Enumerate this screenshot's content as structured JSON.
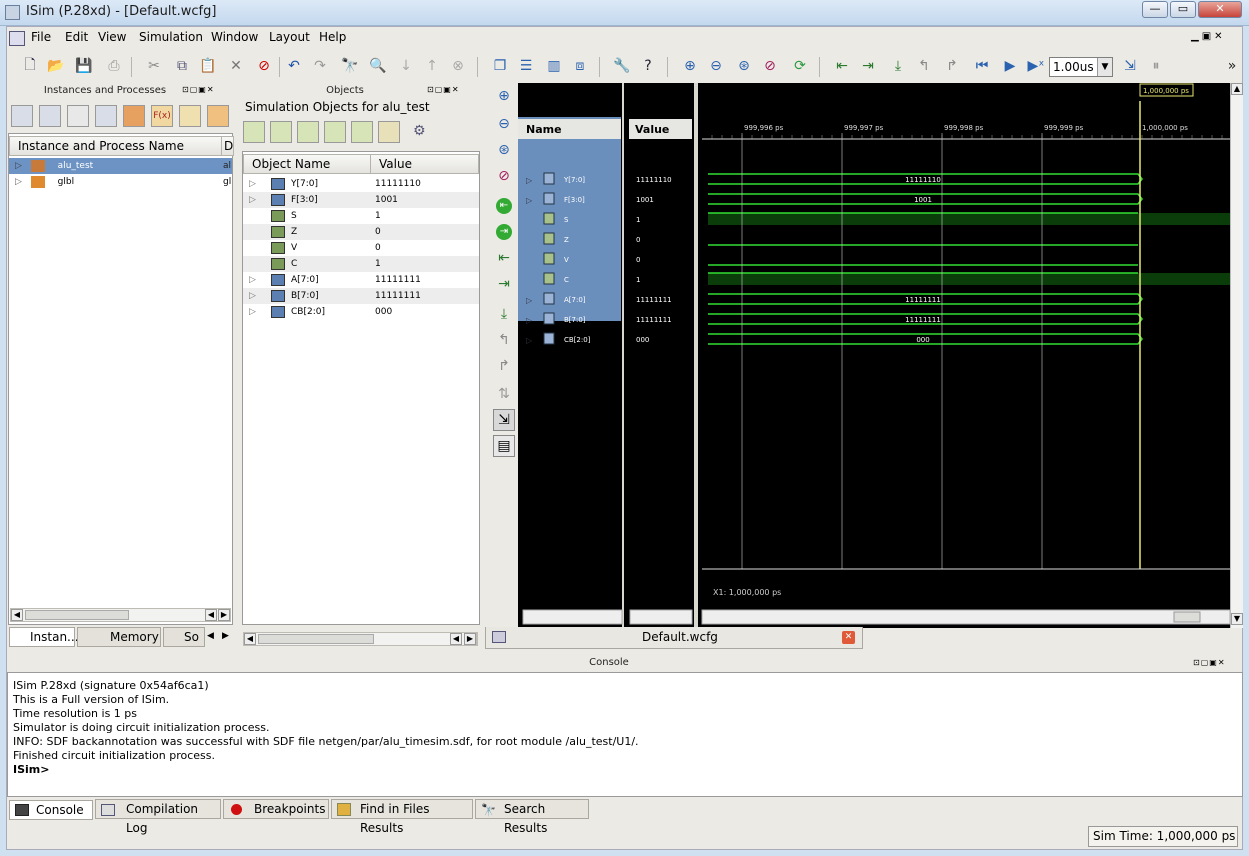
{
  "window": {
    "title": "ISim (P.28xd) - [Default.wcfg]"
  },
  "menu": [
    "File",
    "Edit",
    "View",
    "Simulation",
    "Window",
    "Layout",
    "Help"
  ],
  "toolbar": {
    "time_value": "1.00us"
  },
  "instances_panel": {
    "title": "Instances and Processes",
    "col1": "Instance and Process Name",
    "col2": "D",
    "rows": [
      {
        "name": "alu_test",
        "d": "al"
      },
      {
        "name": "glbl",
        "d": "gl"
      }
    ],
    "tabs": [
      "Instan...",
      "Memory",
      "So"
    ]
  },
  "objects_panel": {
    "title": "Objects",
    "subtitle": "Simulation Objects for alu_test",
    "col1": "Object Name",
    "col2": "Value",
    "rows": [
      {
        "name": "Y[7:0]",
        "value": "11111110"
      },
      {
        "name": "F[3:0]",
        "value": "1001"
      },
      {
        "name": "S",
        "value": "1"
      },
      {
        "name": "Z",
        "value": "0"
      },
      {
        "name": "V",
        "value": "0"
      },
      {
        "name": "C",
        "value": "1"
      },
      {
        "name": "A[7:0]",
        "value": "11111111"
      },
      {
        "name": "B[7:0]",
        "value": "11111111"
      },
      {
        "name": "CB[2:0]",
        "value": "000"
      }
    ]
  },
  "wave": {
    "name_header": "Name",
    "value_header": "Value",
    "signals": [
      {
        "name": "Y[7:0]",
        "value": "11111110",
        "bus": true,
        "label": "11111110"
      },
      {
        "name": "F[3:0]",
        "value": "1001",
        "bus": true,
        "label": "1001"
      },
      {
        "name": "S",
        "value": "1",
        "bus": false,
        "level": 1
      },
      {
        "name": "Z",
        "value": "0",
        "bus": false,
        "level": 0
      },
      {
        "name": "V",
        "value": "0",
        "bus": false,
        "level": 0
      },
      {
        "name": "C",
        "value": "1",
        "bus": false,
        "level": 1
      },
      {
        "name": "A[7:0]",
        "value": "11111111",
        "bus": true,
        "label": "11111111"
      },
      {
        "name": "B[7:0]",
        "value": "11111111",
        "bus": true,
        "label": "11111111"
      },
      {
        "name": "CB[2:0]",
        "value": "000",
        "bus": true,
        "label": "000"
      }
    ],
    "ticks": [
      "999,996 ps",
      "999,997 ps",
      "999,998 ps",
      "999,999 ps",
      "1,000,000 ps"
    ],
    "cursor_label": "1,000,000 ps",
    "x1_label": "X1: 1,000,000 ps",
    "tab_label": "Default.wcfg",
    "colors": {
      "wave": "#33dd33",
      "background": "#000000",
      "cursor": "#e8e870",
      "name_bg": "#6b8fbd"
    }
  },
  "console": {
    "title": "Console",
    "lines": [
      "ISim P.28xd (signature 0x54af6ca1)",
      "This is a Full version of ISim.",
      "Time resolution is 1 ps",
      "Simulator is doing circuit initialization process.",
      "INFO: SDF backannotation was successful with SDF file netgen/par/alu_timesim.sdf, for root module /alu_test/U1/.",
      "Finished circuit initialization process."
    ],
    "prompt": "ISim>",
    "tabs": [
      "Console",
      "Compilation Log",
      "Breakpoints",
      "Find in Files Results",
      "Search Results"
    ]
  },
  "status": {
    "sim_time": "Sim Time: 1,000,000 ps"
  }
}
